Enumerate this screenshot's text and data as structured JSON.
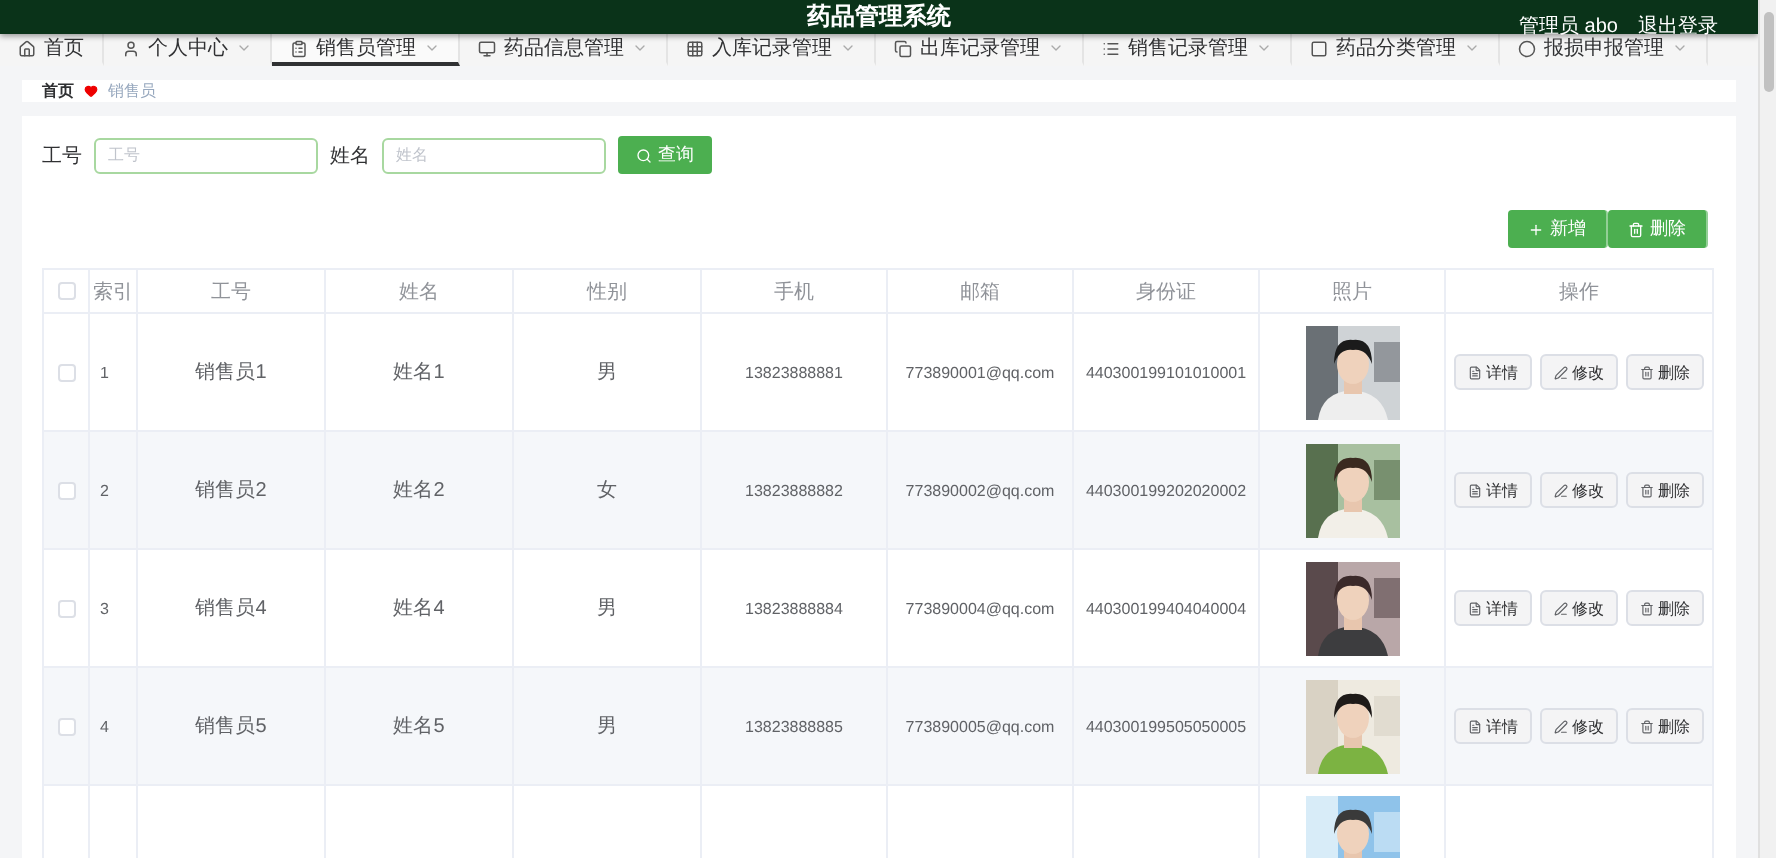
{
  "header": {
    "title": "药品管理系统",
    "user": "管理员 abo",
    "logout": "退出登录"
  },
  "nav": [
    {
      "label": "首页",
      "dropdown": false,
      "selected": false
    },
    {
      "label": "个人中心",
      "dropdown": true,
      "selected": false
    },
    {
      "label": "销售员管理",
      "dropdown": true,
      "selected": true
    },
    {
      "label": "药品信息管理",
      "dropdown": true,
      "selected": false
    },
    {
      "label": "入库记录管理",
      "dropdown": true,
      "selected": false
    },
    {
      "label": "出库记录管理",
      "dropdown": true,
      "selected": false
    },
    {
      "label": "销售记录管理",
      "dropdown": true,
      "selected": false
    },
    {
      "label": "药品分类管理",
      "dropdown": true,
      "selected": false
    },
    {
      "label": "报损申报管理",
      "dropdown": true,
      "selected": false
    }
  ],
  "breadcrumb": {
    "home": "首页",
    "current": "销售员"
  },
  "search": {
    "fields": [
      {
        "label": "工号",
        "placeholder": "工号"
      },
      {
        "label": "姓名",
        "placeholder": "姓名"
      }
    ],
    "button": "查询"
  },
  "actions": {
    "add": "新增",
    "delete": "删除"
  },
  "table": {
    "select_all_checked": false,
    "columns": [
      "索引",
      "工号",
      "姓名",
      "性别",
      "手机",
      "邮箱",
      "身份证",
      "照片",
      "操作"
    ],
    "rows": [
      {
        "index": "1",
        "id": "销售员1",
        "name": "姓名1",
        "gender": "男",
        "phone": "13823888881",
        "email": "773890001@qq.com",
        "idcard": "440300199101010001",
        "photo": {
          "kind": "picture"
        },
        "checked": false,
        "buttons": [
          "详情",
          "修改",
          "删除"
        ]
      },
      {
        "index": "2",
        "id": "销售员2",
        "name": "姓名2",
        "gender": "女",
        "phone": "13823888882",
        "email": "773890002@qq.com",
        "idcard": "440300199202020002",
        "photo": {
          "kind": "picture"
        },
        "checked": false,
        "buttons": [
          "详情",
          "修改",
          "删除"
        ]
      },
      {
        "index": "3",
        "id": "销售员4",
        "name": "姓名4",
        "gender": "男",
        "phone": "13823888884",
        "email": "773890004@qq.com",
        "idcard": "440300199404040004",
        "photo": {
          "kind": "picture"
        },
        "checked": false,
        "buttons": [
          "详情",
          "修改",
          "删除"
        ]
      },
      {
        "index": "4",
        "id": "销售员5",
        "name": "姓名5",
        "gender": "男",
        "phone": "13823888885",
        "email": "773890005@qq.com",
        "idcard": "440300199505050005",
        "photo": {
          "kind": "picture"
        },
        "checked": false,
        "buttons": [
          "详情",
          "修改",
          "删除"
        ]
      }
    ],
    "next_row": {
      "photo": {
        "kind": "picture"
      }
    }
  }
}
